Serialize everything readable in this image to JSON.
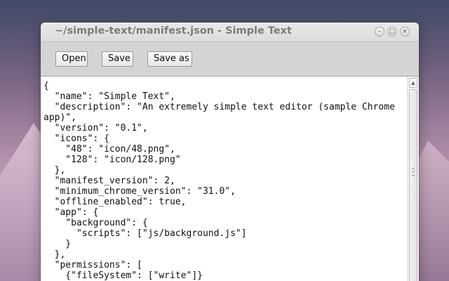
{
  "window": {
    "title": "~/simple-text/manifest.json - Simple Text",
    "controls": {
      "minimize": "–",
      "maximize": "□",
      "close": "×"
    }
  },
  "toolbar": {
    "open_label": "Open",
    "save_label": "Save",
    "save_as_label": "Save as"
  },
  "editor": {
    "content": "{\n  \"name\": \"Simple Text\",\n  \"description\": \"An extremely simple text editor (sample Chrome\napp)\",\n  \"version\": \"0.1\",\n  \"icons\": {\n    \"48\": \"icon/48.png\",\n    \"128\": \"icon/128.png\"\n  },\n  \"manifest_version\": 2,\n  \"minimum_chrome_version\": \"31.0\",\n  \"offline_enabled\": true,\n  \"app\": {\n    \"background\": {\n      \"scripts\": [\"js/background.js\"]\n    }\n  },\n  \"permissions\": [\n    {\"fileSystem\": [\"write\"]}"
  },
  "scrollbar": {
    "up_arrow": "▲"
  }
}
